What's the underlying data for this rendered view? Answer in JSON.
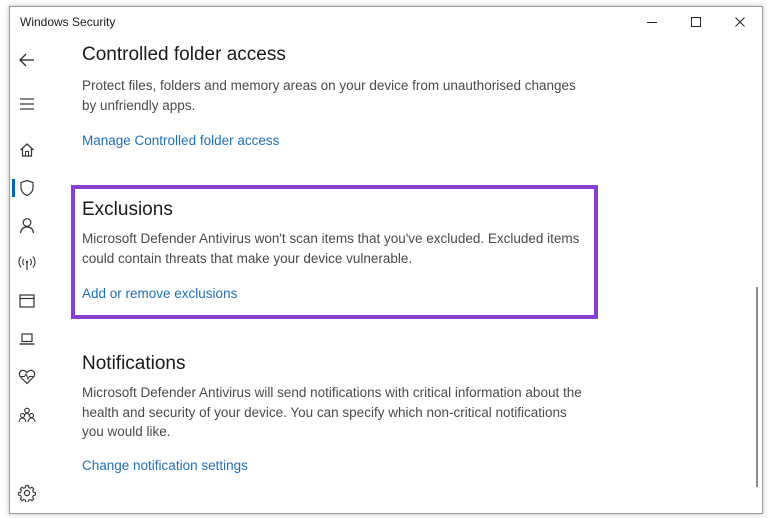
{
  "window": {
    "title": "Windows Security"
  },
  "sidebar": {
    "items": [
      {
        "icon": "back-arrow-icon"
      },
      {
        "icon": "hamburger-menu-icon"
      },
      {
        "icon": "home-icon"
      },
      {
        "icon": "shield-icon",
        "active": true
      },
      {
        "icon": "person-icon"
      },
      {
        "icon": "network-wifi-icon"
      },
      {
        "icon": "app-browser-control-icon"
      },
      {
        "icon": "device-laptop-icon"
      },
      {
        "icon": "heart-health-icon"
      },
      {
        "icon": "family-icon"
      },
      {
        "icon": "gear-icon"
      }
    ]
  },
  "sections": {
    "controlled_folder": {
      "heading": "Controlled folder access",
      "description": "Protect files, folders and memory areas on your device from unauthorised changes by unfriendly apps.",
      "link": "Manage Controlled folder access"
    },
    "exclusions": {
      "heading": "Exclusions",
      "description": "Microsoft Defender Antivirus won't scan items that you've excluded. Excluded items could contain threats that make your device vulnerable.",
      "link": "Add or remove exclusions"
    },
    "notifications": {
      "heading": "Notifications",
      "description": "Microsoft Defender Antivirus will send notifications with critical information about the health and security of your device. You can specify which non-critical notifications you would like.",
      "link": "Change notification settings"
    }
  },
  "colors": {
    "accent": "#0067b8",
    "link": "#1f6fb7",
    "highlight": "#8a3fcf"
  }
}
